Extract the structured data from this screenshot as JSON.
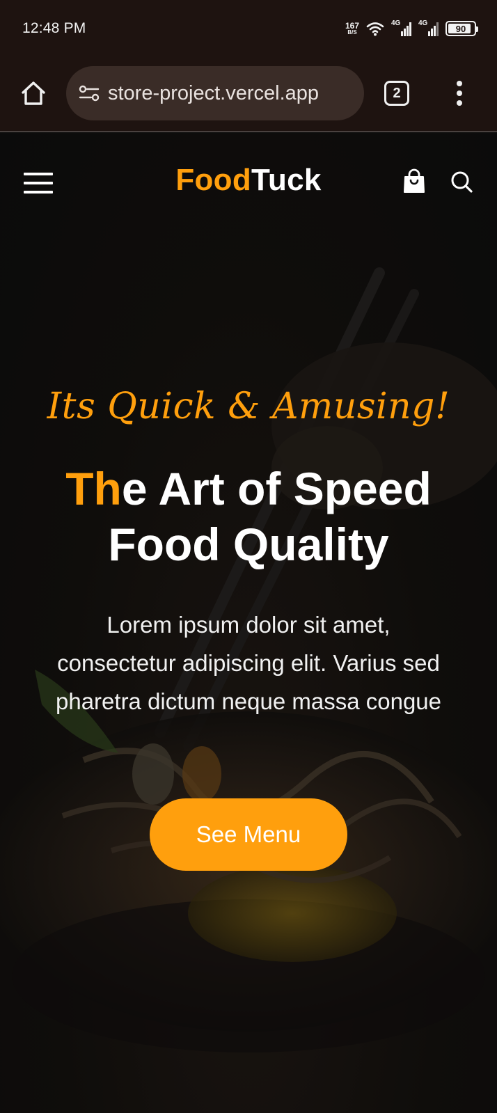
{
  "status_bar": {
    "time": "12:48 PM",
    "net_speed_value": "167",
    "net_speed_unit": "B/S",
    "sim1_label": "4G",
    "sim2_label": "4G",
    "battery": "90",
    "battery_level": 0.9
  },
  "browser": {
    "url": "store-project.vercel.app",
    "tab_count": "2",
    "icons": [
      "home-icon",
      "site-settings-icon",
      "tabs-icon",
      "more-vert-icon"
    ]
  },
  "site": {
    "logo_part1": "Food",
    "logo_part2": "Tuck",
    "icons": [
      "hamburger-menu-icon",
      "shopping-bag-icon",
      "search-icon"
    ],
    "colors": {
      "accent": "#ff9f0d",
      "background": "#0d0d0d"
    }
  },
  "hero": {
    "tagline": "Its Quick & Amusing!",
    "headline_highlight": "Th",
    "headline_line1_rest": "e Art of Speed",
    "headline_line2": "Food Quality",
    "description": "Lorem ipsum dolor sit amet, consectetur adipiscing elit. Varius sed pharetra dictum neque massa congue",
    "cta_label": "See Menu"
  }
}
